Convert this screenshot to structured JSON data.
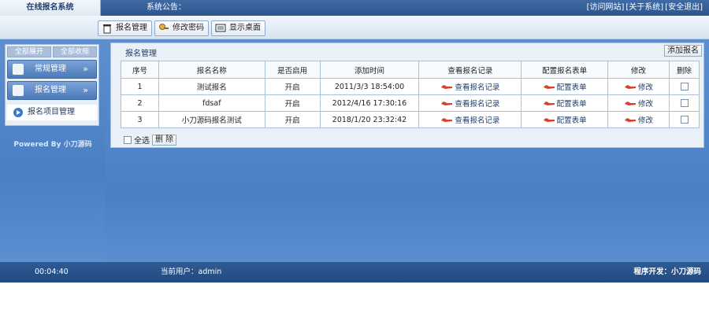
{
  "topbar": {
    "system_name": "在线报名系统",
    "notice_label": "系统公告：",
    "links": [
      "[访问网站]",
      "[关于系统]",
      "[安全退出]"
    ]
  },
  "toolbar": {
    "buttons": [
      "报名管理",
      "修改密码",
      "显示桌面"
    ]
  },
  "sidebar": {
    "expand_all": "全部展开",
    "collapse_all": "全部收缩",
    "menus": [
      "常规管理",
      "报名管理"
    ],
    "submenu": "报名项目管理",
    "powered_by": "Powered By 小刀源码"
  },
  "main": {
    "section_title": "报名管理",
    "add_button": "添加报名",
    "columns": [
      "序号",
      "报名名称",
      "是否启用",
      "添加时间",
      "查看报名记录",
      "配置报名表单",
      "修改",
      "删除"
    ],
    "rows": [
      {
        "id": "1",
        "name": "测试报名",
        "enabled": "开启",
        "time": "2011/3/3 18:54:00",
        "records": "查看报名记录",
        "form": "配置表单",
        "edit": "修改"
      },
      {
        "id": "2",
        "name": "fdsaf",
        "enabled": "开启",
        "time": "2012/4/16 17:30:16",
        "records": "查看报名记录",
        "form": "配置表单",
        "edit": "修改"
      },
      {
        "id": "3",
        "name": "小刀源码报名测试",
        "enabled": "开启",
        "time": "2018/1/20 23:32:42",
        "records": "查看报名记录",
        "form": "配置表单",
        "edit": "修改"
      }
    ],
    "select_all": "全选",
    "delete_button": "删 除"
  },
  "status": {
    "time": "00:04:40",
    "current_user": "当前用户：admin",
    "developer": "程序开发：小刀源码"
  },
  "colors": {
    "accent": "#3a79c9",
    "header": "#2e568c"
  }
}
